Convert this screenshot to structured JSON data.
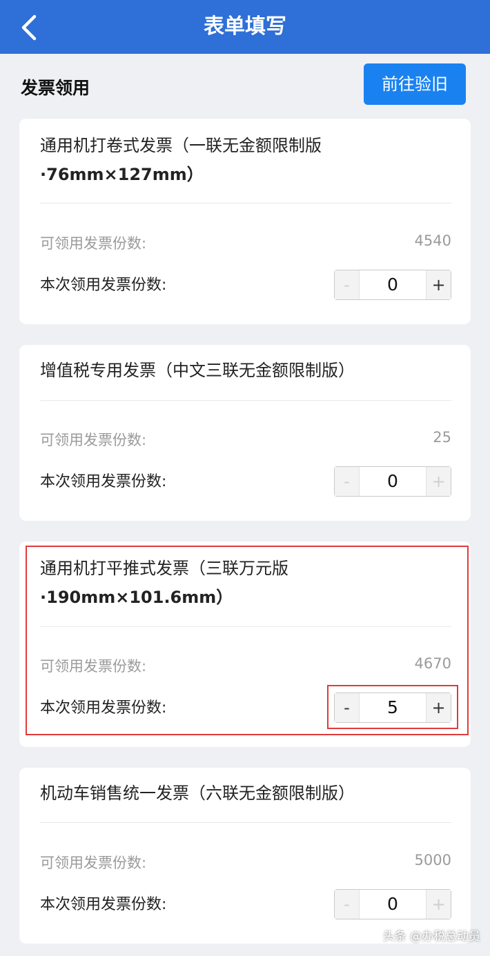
{
  "header": {
    "title": "表单填写"
  },
  "section": {
    "title": "发票领用",
    "button_label": "前往验旧"
  },
  "cards": [
    {
      "name_line1": "通用机打卷式发票（一联无金额限制版",
      "name_line2": "·76mm×127mm）",
      "available_label": "可领用发票份数:",
      "available_value": "4540",
      "qty_label": "本次领用发票份数:",
      "minus": "-",
      "qty": "0",
      "plus": "+"
    },
    {
      "name_line1": "增值税专用发票（中文三联无金额限制版）",
      "available_label": "可领用发票份数:",
      "available_value": "25",
      "qty_label": "本次领用发票份数:",
      "minus": "-",
      "qty": "0",
      "plus": "+"
    },
    {
      "name_line1": "通用机打平推式发票（三联万元版",
      "name_line2": "·190mm×101.6mm）",
      "available_label": "可领用发票份数:",
      "available_value": "4670",
      "qty_label": "本次领用发票份数:",
      "minus": "-",
      "qty": "5",
      "plus": "+"
    },
    {
      "name_line1": "机动车销售统一发票（六联无金额限制版）",
      "available_label": "可领用发票份数:",
      "available_value": "5000",
      "qty_label": "本次领用发票份数:",
      "minus": "-",
      "qty": "0",
      "plus": "+"
    }
  ],
  "watermark": "头条 @办税总动员",
  "colors": {
    "header": "#2e6fd8",
    "button": "#1a82f0",
    "highlight": "#e03a3a"
  },
  "icons": {
    "back": "chevron-left-icon"
  }
}
